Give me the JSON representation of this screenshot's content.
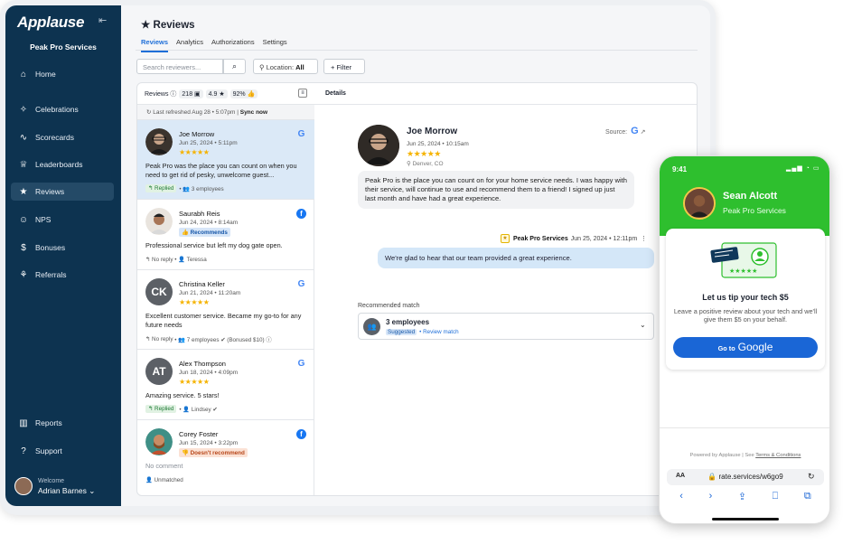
{
  "sidebar": {
    "brand": "Applause",
    "org": "Peak Pro Services",
    "items": [
      {
        "label": "Home",
        "icon": "home-icon",
        "glyph": "⌂"
      },
      {
        "label": "Celebrations",
        "icon": "confetti-icon",
        "glyph": "✧"
      },
      {
        "label": "Scorecards",
        "icon": "trend-icon",
        "glyph": "∿"
      },
      {
        "label": "Leaderboards",
        "icon": "trophy-icon",
        "glyph": "♕"
      },
      {
        "label": "Reviews",
        "icon": "star-icon",
        "glyph": "★"
      },
      {
        "label": "NPS",
        "icon": "smile-icon",
        "glyph": "☺"
      },
      {
        "label": "Bonuses",
        "icon": "dollar-icon",
        "glyph": "$"
      },
      {
        "label": "Referrals",
        "icon": "handshake-icon",
        "glyph": "⚘"
      },
      {
        "label": "Reports",
        "icon": "chart-icon",
        "glyph": "▥"
      },
      {
        "label": "Support",
        "icon": "help-icon",
        "glyph": "?"
      }
    ],
    "welcome_label": "Welcome",
    "user_name": "Adrian Barnes ⌄"
  },
  "page": {
    "title": "Reviews",
    "tabs": [
      "Reviews",
      "Analytics",
      "Authorizations",
      "Settings"
    ]
  },
  "toolbar": {
    "search_placeholder": "Search reviewers...",
    "location_label": "Location:",
    "location_value": "All",
    "filter_label": "+ Filter"
  },
  "list": {
    "header_label": "Reviews ⓘ",
    "count": "218 ▣",
    "rating": "4.9 ★",
    "percent": "92% 👍",
    "refreshed": "↻ Last refreshed Aug 28 • 5:07pm |",
    "sync": "Sync now",
    "items": [
      {
        "name": "Joe Morrow",
        "date": "Jun 25, 2024 • 5:11pm",
        "stars": "★★★★★",
        "source": "G",
        "text": "Peak Pro was the place you can count on when you need to get rid of pesky, unwelcome guest...",
        "status": "↰ Replied",
        "meta": "• 👥 3 employees"
      },
      {
        "name": "Saurabh Reis",
        "date": "Jun 24, 2024 • 8:14am",
        "badge": "👍 Recommends",
        "source": "f",
        "text": "Professional service but left my dog gate open.",
        "status": "↰ No reply",
        "meta": "• 👤 Teressa"
      },
      {
        "name": "Christina Keller",
        "initials": "CK",
        "date": "Jun 21, 2024 • 11:20am",
        "stars": "★★★★★",
        "source": "G",
        "text": "Excellent customer service. Became my go-to for any future needs",
        "status": "↰ No reply",
        "meta": "• 👥 7 employees ✔ (Bonused $10) ⓘ"
      },
      {
        "name": "Alex Thompson",
        "initials": "AT",
        "date": "Jun 18, 2024 • 4:09pm",
        "stars": "★★★★★",
        "source": "G",
        "text": "Amazing service. 5 stars!",
        "status": "↰ Replied",
        "meta": "• 👤 Lindsey ✔"
      },
      {
        "name": "Corey Foster",
        "date": "Jun 15, 2024 • 3:22pm",
        "badge": "👎 Doesn't recommend",
        "source": "f",
        "text": "No comment",
        "meta": "👤 Unmatched"
      }
    ]
  },
  "details": {
    "header": "Details",
    "name": "Joe Morrow",
    "date": "Jun 25, 2024 • 10:15am",
    "stars": "★★★★★",
    "location": "⚲ Denver, CO",
    "source_label": "Source:",
    "source_glyph": "G",
    "review": "Peak Pro is the place you can count on for your home service needs. I was happy with their service, will continue to use and recommend them to a friend! I signed up just last month and have had a great experience.",
    "reply_org": "Peak Pro Services",
    "reply_date": "Jun 25, 2024 • 12:11pm",
    "reply_text": "We're glad to hear that our team provided a great experience.",
    "match_label": "Recommended match",
    "match_title": "3 employees",
    "match_suggested": "Suggested",
    "match_link": "• Review match"
  },
  "phone": {
    "time": "9:41",
    "status": "▂▄▆ ◔ ▭",
    "tech_name": "Sean Alcott",
    "org": "Peak Pro Services",
    "card_title": "Let us tip your tech $5",
    "card_desc": "Leave a positive review about your tech and we'll give them $5 on your behalf.",
    "btn_label": "Go to",
    "btn_brand": "Google",
    "powered": "Powered by Applause  |  See",
    "terms": "Terms & Conditions",
    "aa": "AA",
    "url": "🔒 rate.services/w6go9",
    "nav": [
      "‹",
      "›",
      "⇪",
      "⎕",
      "⧉"
    ]
  },
  "colors": {
    "sidebar": "#0d3350",
    "accent": "#1f6fd8",
    "star": "#f5b301",
    "phone_green": "#2ebf2e"
  }
}
